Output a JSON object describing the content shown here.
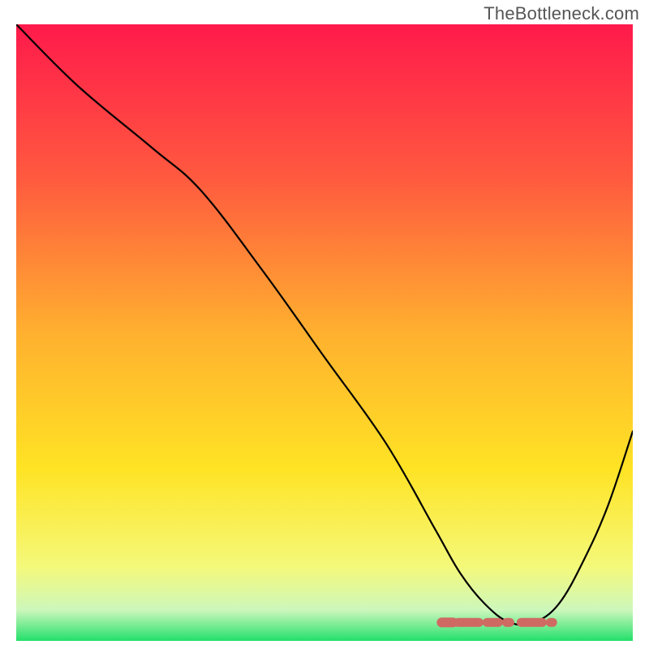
{
  "watermark": "TheBottleneck.com",
  "chart_data": {
    "type": "line",
    "title": "",
    "xlabel": "",
    "ylabel": "",
    "xlim": [
      0,
      100
    ],
    "ylim": [
      0,
      100
    ],
    "grid": false,
    "legend": false,
    "series": [
      {
        "name": "curve",
        "x": [
          0,
          10,
          22,
          30,
          40,
          50,
          60,
          68,
          72,
          76,
          80,
          84,
          88,
          92,
          96,
          100
        ],
        "y": [
          100,
          90,
          80,
          73,
          60,
          46,
          32,
          18,
          11,
          6,
          3,
          3,
          6,
          13,
          22,
          34
        ],
        "color": "#000000"
      }
    ],
    "marker_region": {
      "name": "highlighted-floor",
      "color": "#cf6a63",
      "x_start": 69,
      "x_end": 87,
      "y": 3
    },
    "background_gradient": {
      "stops": [
        {
          "pos": 0.0,
          "color": "#ff1a4b"
        },
        {
          "pos": 0.25,
          "color": "#ff5a3f"
        },
        {
          "pos": 0.5,
          "color": "#ffb02f"
        },
        {
          "pos": 0.72,
          "color": "#ffe324"
        },
        {
          "pos": 0.88,
          "color": "#f4f97a"
        },
        {
          "pos": 0.95,
          "color": "#cdf7bc"
        },
        {
          "pos": 1.0,
          "color": "#23e06b"
        }
      ]
    }
  }
}
